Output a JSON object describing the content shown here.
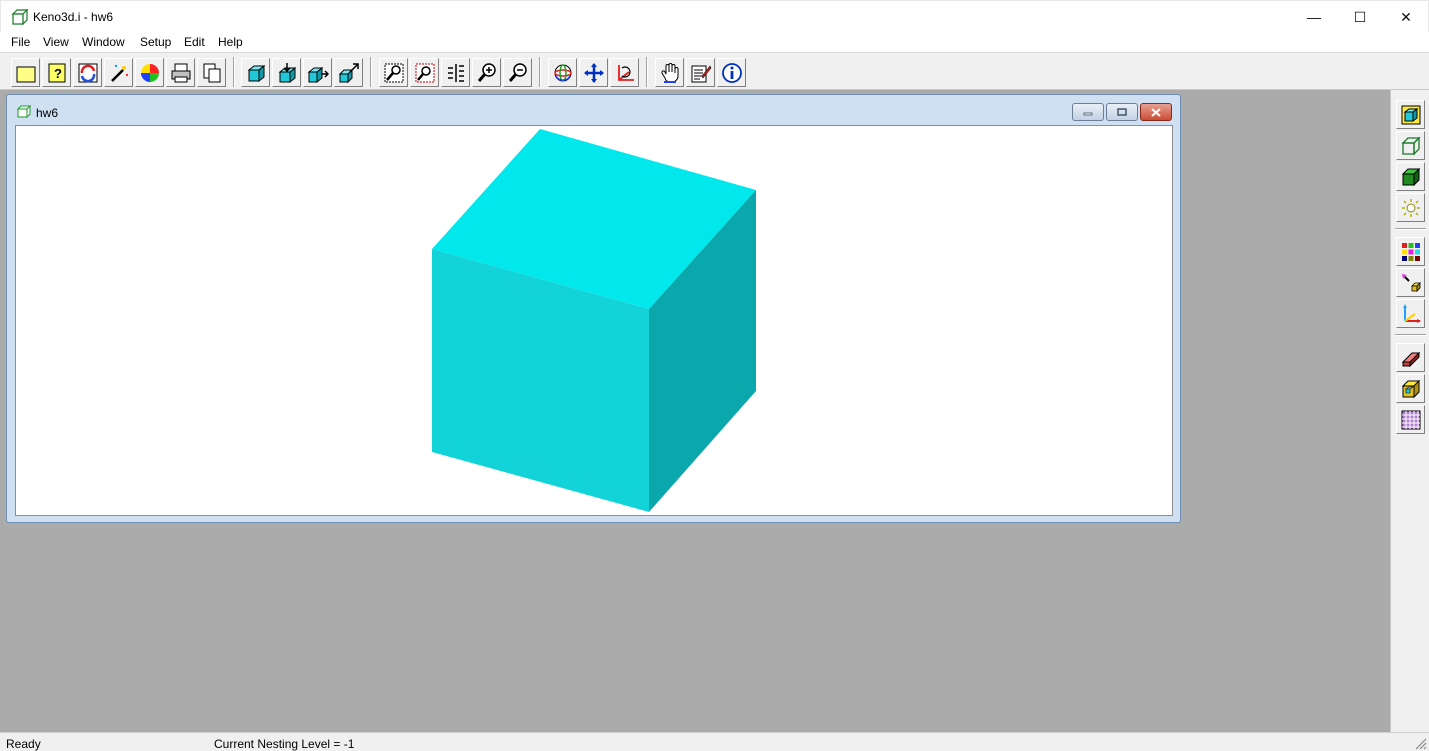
{
  "window": {
    "title": "Keno3d.i - hw6",
    "controls": {
      "minimize": "—",
      "maximize": "☐",
      "close": "✕"
    }
  },
  "menu": {
    "items": [
      {
        "label": "File"
      },
      {
        "label": "View"
      },
      {
        "label": "Window"
      },
      {
        "label": "Setup"
      },
      {
        "label": "Edit"
      },
      {
        "label": "Help"
      }
    ]
  },
  "toolbar": {
    "buttons": [
      "open-folder-icon",
      "help-file-icon",
      "refresh-icon",
      "magic-wand-icon",
      "color-wheel-icon",
      "print-icon",
      "copy-page-icon",
      "view-cube-icon",
      "cube-insert-icon",
      "cube-move-icon",
      "cube-export-icon",
      "zoom-window-icon",
      "zoom-extents-icon",
      "scale-ruler-icon",
      "zoom-in-icon",
      "zoom-out-icon",
      "rotate-globe-icon",
      "pan-arrows-icon",
      "axis-rotate-icon",
      "hand-pick-icon",
      "edit-properties-icon",
      "info-icon"
    ]
  },
  "right_toolbar": {
    "buttons": [
      "shaded-view-icon",
      "wireframe-view-icon",
      "solid-view-icon",
      "lighting-icon",
      "palette-grid-icon",
      "light-source-icon",
      "axes-icon",
      "eraser-icon",
      "assembly-icon",
      "mesh-grid-icon"
    ]
  },
  "child_window": {
    "title": "hw6"
  },
  "colors": {
    "cube_top": "#00e8ec",
    "cube_front": "#12d4d8",
    "cube_right": "#0aa8ac",
    "workspace": "#ababab"
  },
  "status": {
    "ready": "Ready",
    "nesting": "Current Nesting Level = -1"
  }
}
